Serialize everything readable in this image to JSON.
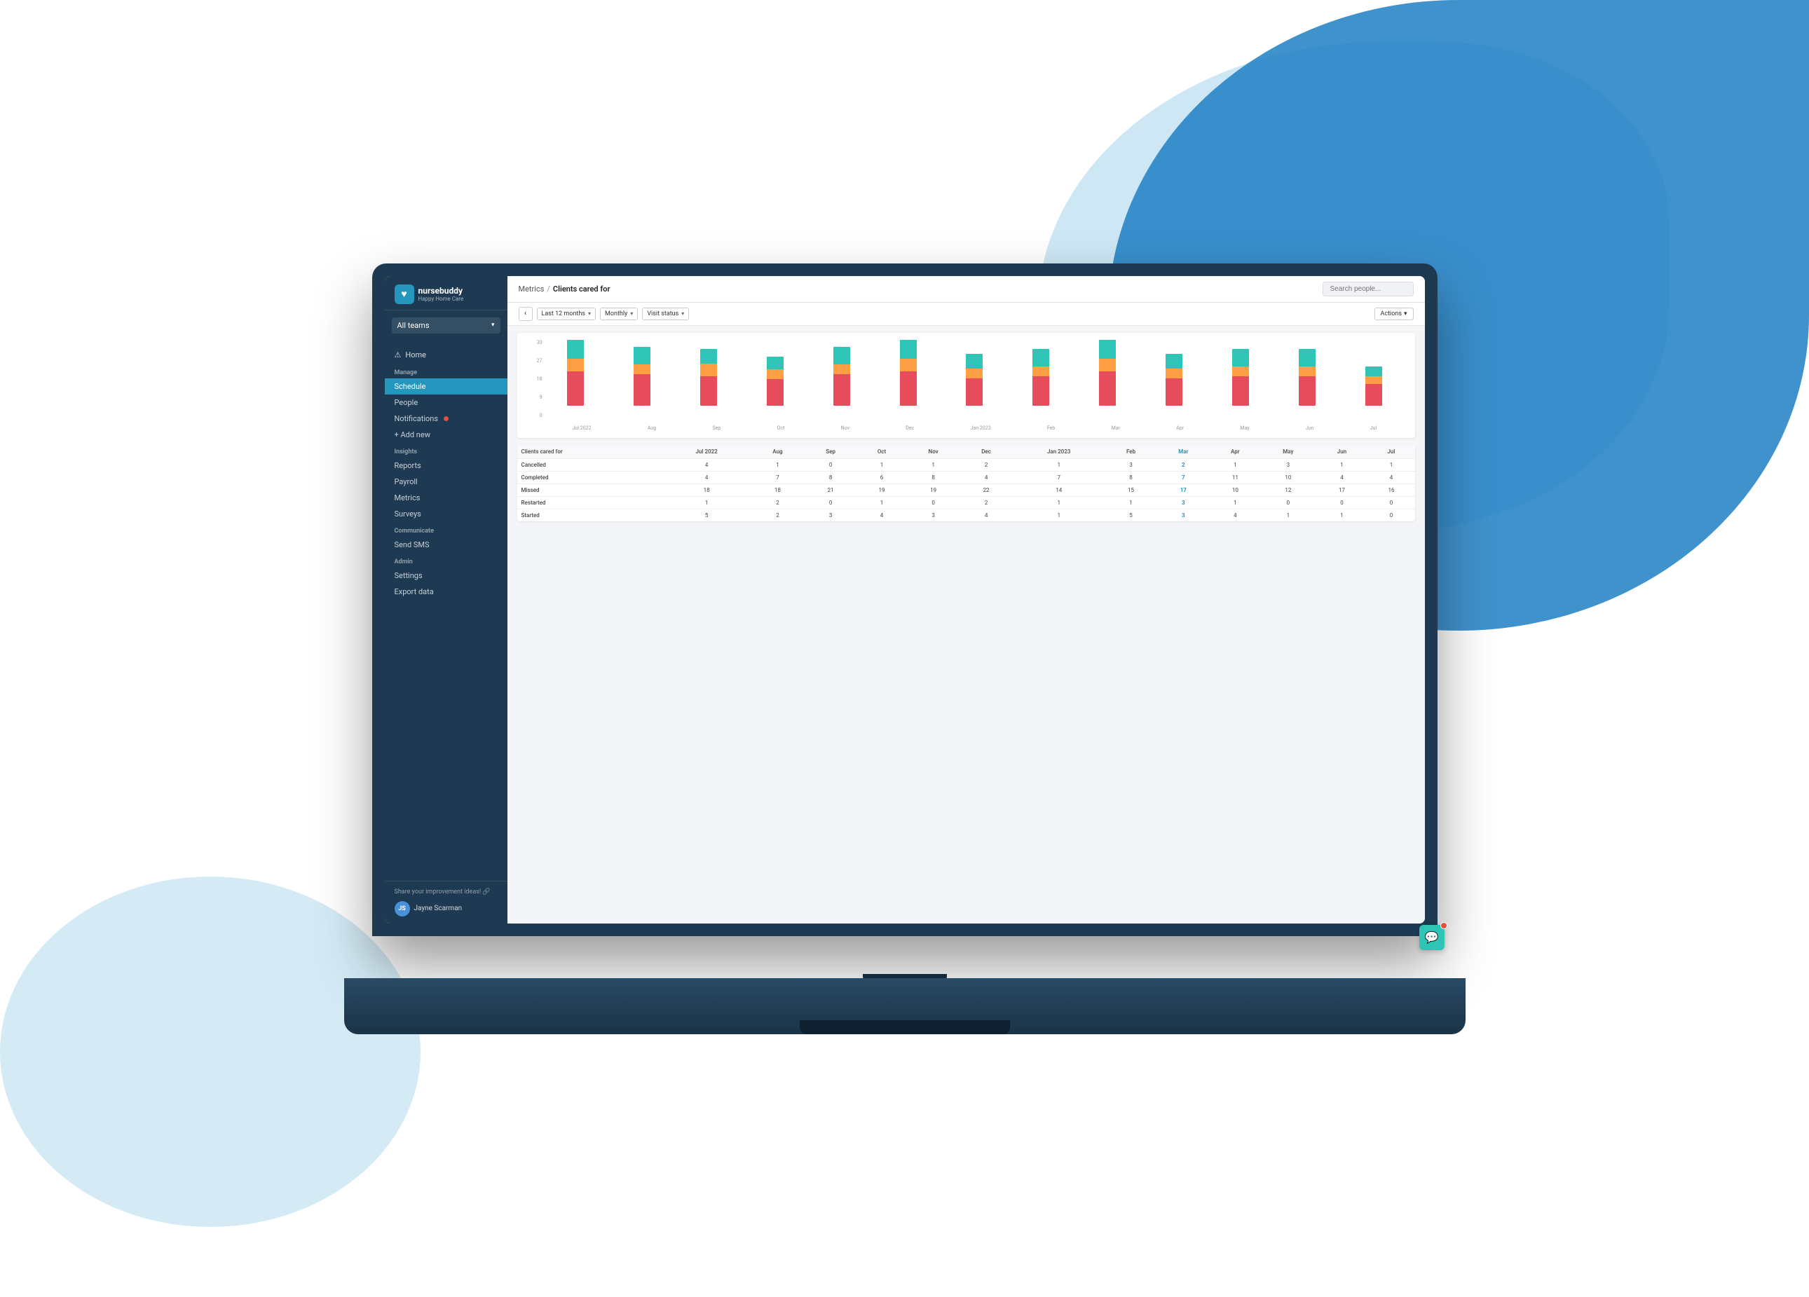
{
  "page": {
    "title": "nursebuddy",
    "subtitle": "Happy Home Care"
  },
  "sidebar": {
    "logo": {
      "icon": "♥",
      "title": "nursebuddy",
      "subtitle": "Happy Home Care"
    },
    "team_selector": {
      "label": "All teams",
      "arrow": "▾"
    },
    "nav": {
      "home_label": "Home",
      "home_icon": "⚠",
      "sections": [
        {
          "title": "Manage",
          "items": [
            {
              "label": "Schedule",
              "active": false
            },
            {
              "label": "People",
              "active": false
            },
            {
              "label": "Notifications",
              "active": false,
              "badge": true
            },
            {
              "label": "+ Add new",
              "active": false
            }
          ]
        },
        {
          "title": "Insights",
          "items": [
            {
              "label": "Reports",
              "active": false
            },
            {
              "label": "Payroll",
              "active": false
            },
            {
              "label": "Metrics",
              "active": true
            },
            {
              "label": "Surveys",
              "active": false
            }
          ]
        },
        {
          "title": "Communicate",
          "items": [
            {
              "label": "Send SMS",
              "active": false
            }
          ]
        },
        {
          "title": "Admin",
          "items": [
            {
              "label": "Settings",
              "active": false
            },
            {
              "label": "Export data",
              "active": false
            }
          ]
        }
      ]
    },
    "share_ideas": "Share your improvement ideas! 🔗",
    "user": {
      "name": "Jayne Scarman",
      "initials": "JS"
    }
  },
  "topbar": {
    "breadcrumb_parent": "Metrics",
    "breadcrumb_sep": "/",
    "breadcrumb_current": "Clients cared for",
    "search_placeholder": "Search people..."
  },
  "filters": {
    "nav_prev": "‹",
    "period": "Last 12 months",
    "period_arrow": "▾",
    "frequency": "Monthly",
    "frequency_arrow": "▾",
    "visit_status": "Visit status",
    "visit_status_arrow": "▾",
    "actions": "Actions",
    "actions_arrow": "▾"
  },
  "chart": {
    "y_labels": [
      "30",
      "27",
      "18",
      "9",
      "0"
    ],
    "x_labels": [
      "Jul 2022",
      "Aug",
      "Sep",
      "Oct",
      "Nov",
      "Dec",
      "Jan 2023",
      "Feb",
      "Mar",
      "Apr",
      "May",
      "Jun",
      "Jul"
    ],
    "bars": [
      {
        "teal": 8,
        "orange": 5,
        "red": 14
      },
      {
        "teal": 7,
        "orange": 4,
        "red": 13
      },
      {
        "teal": 6,
        "orange": 5,
        "red": 12
      },
      {
        "teal": 5,
        "orange": 4,
        "red": 11
      },
      {
        "teal": 7,
        "orange": 4,
        "red": 13
      },
      {
        "teal": 8,
        "orange": 5,
        "red": 14
      },
      {
        "teal": 6,
        "orange": 4,
        "red": 11
      },
      {
        "teal": 7,
        "orange": 4,
        "red": 12
      },
      {
        "teal": 8,
        "orange": 5,
        "red": 14
      },
      {
        "teal": 6,
        "orange": 4,
        "red": 11
      },
      {
        "teal": 7,
        "orange": 4,
        "red": 12
      },
      {
        "teal": 7,
        "orange": 4,
        "red": 12
      },
      {
        "teal": 4,
        "orange": 3,
        "red": 9
      }
    ]
  },
  "table": {
    "header_label": "Clients cared for",
    "columns": [
      "Jul 2022",
      "Aug",
      "Sep",
      "Oct",
      "Nov",
      "Dec",
      "Jan 2023",
      "Feb",
      "Mar",
      "Apr",
      "May",
      "Jun",
      "Jul"
    ],
    "highlight_col": "Mar",
    "rows": [
      {
        "label": "Cancelled",
        "values": [
          4,
          1,
          0,
          1,
          1,
          2,
          1,
          3,
          2,
          1,
          3,
          1,
          1
        ]
      },
      {
        "label": "Completed",
        "values": [
          4,
          7,
          8,
          6,
          8,
          4,
          7,
          8,
          7,
          11,
          10,
          4,
          4
        ]
      },
      {
        "label": "Missed",
        "values": [
          18,
          18,
          21,
          19,
          19,
          22,
          14,
          15,
          17,
          10,
          12,
          17,
          16
        ]
      },
      {
        "label": "Restarted",
        "values": [
          1,
          2,
          0,
          1,
          0,
          2,
          1,
          1,
          3,
          1,
          0,
          0,
          0
        ]
      },
      {
        "label": "Started",
        "values": [
          5,
          2,
          3,
          4,
          3,
          4,
          1,
          5,
          3,
          4,
          1,
          1,
          0
        ]
      }
    ]
  }
}
